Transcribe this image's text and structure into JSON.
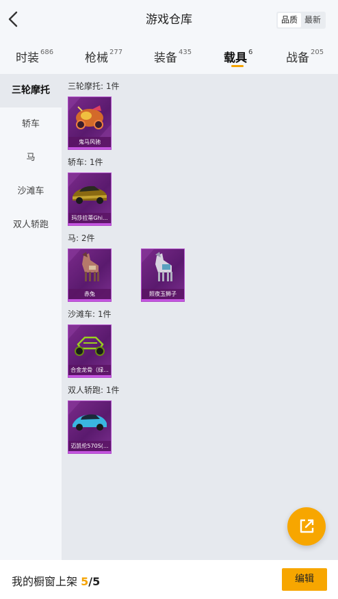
{
  "header": {
    "title": "游戏仓库",
    "sort_options": [
      "品质",
      "最新"
    ],
    "sort_active": "品质"
  },
  "tabs": [
    {
      "label": "时装",
      "count": "686"
    },
    {
      "label": "枪械",
      "count": "277"
    },
    {
      "label": "装备",
      "count": "435"
    },
    {
      "label": "载具",
      "count": "6",
      "active": true
    },
    {
      "label": "战备",
      "count": "205"
    }
  ],
  "sidebar": {
    "items": [
      {
        "label": "三轮摩托",
        "active": true
      },
      {
        "label": "轿车"
      },
      {
        "label": "马"
      },
      {
        "label": "沙滩车"
      },
      {
        "label": "双人轿跑"
      }
    ]
  },
  "groups": [
    {
      "label": "三轮摩托: 1件",
      "items": [
        {
          "name": "鬼马风驰",
          "icon": "tricycle-art"
        }
      ]
    },
    {
      "label": "轿车: 1件",
      "items": [
        {
          "name": "玛莎拉蒂Ghi...",
          "icon": "sedan-art"
        }
      ]
    },
    {
      "label": "马: 2件",
      "items": [
        {
          "name": "赤兔",
          "icon": "horse-art"
        },
        {
          "name": "照夜玉狮子",
          "icon": "horse-art"
        }
      ]
    },
    {
      "label": "沙滩车: 1件",
      "items": [
        {
          "name": "合金龙骨（绿...",
          "icon": "buggy-art"
        }
      ]
    },
    {
      "label": "双人轿跑: 1件",
      "items": [
        {
          "name": "迈凯伦570S(...",
          "icon": "sportscar-art"
        }
      ]
    }
  ],
  "footer": {
    "label": "我的橱窗上架",
    "current": "5",
    "separator": "/",
    "total": "5",
    "edit_label": "编辑"
  },
  "colors": {
    "accent": "#f7a600",
    "card_purple": "#6a2180",
    "content_bg": "#e6e9ee",
    "page_bg": "#f5f7fa"
  }
}
